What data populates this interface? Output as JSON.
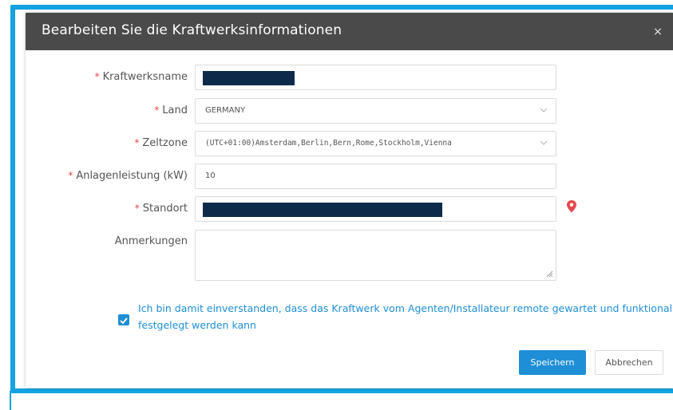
{
  "dialog": {
    "title": "Bearbeiten Sie die Kraftwerksinformationen",
    "close_glyph": "×"
  },
  "form": {
    "plant_name": {
      "label": "Kraftwerksname",
      "required": "*",
      "value": ""
    },
    "country": {
      "label": "Land",
      "required": "*",
      "value": "GERMANY"
    },
    "timezone": {
      "label": "Zeltzone",
      "required": "*",
      "value": "(UTC+01:00)Amsterdam,Berlin,Bern,Rome,Stockholm,Vienna"
    },
    "capacity": {
      "label": "Anlagenleistung (kW)",
      "required": "*",
      "value": "10"
    },
    "location": {
      "label": "Standort",
      "required": "*",
      "value": ""
    },
    "remarks": {
      "label": "Anmerkungen",
      "value": ""
    }
  },
  "consent": {
    "checked": true,
    "text": "Ich bin damit einverstanden, dass das Kraftwerk vom Agenten/Installateur remote gewartet und funktional festgelegt werden kann"
  },
  "buttons": {
    "save": "Speichern",
    "cancel": "Abbrechen"
  },
  "colors": {
    "accent": "#1e8fd6",
    "highlight_frame": "#14a2e0",
    "header_bg": "#4a4a4a",
    "required": "#e64545",
    "redaction": "#0d2a4a",
    "pin": "#e5484d"
  },
  "icons": {
    "close": "close-icon",
    "dropdown": "chevron-down-icon",
    "location": "map-pin-icon",
    "resize": "resize-grip-icon",
    "checkbox": "checkmark-icon"
  }
}
